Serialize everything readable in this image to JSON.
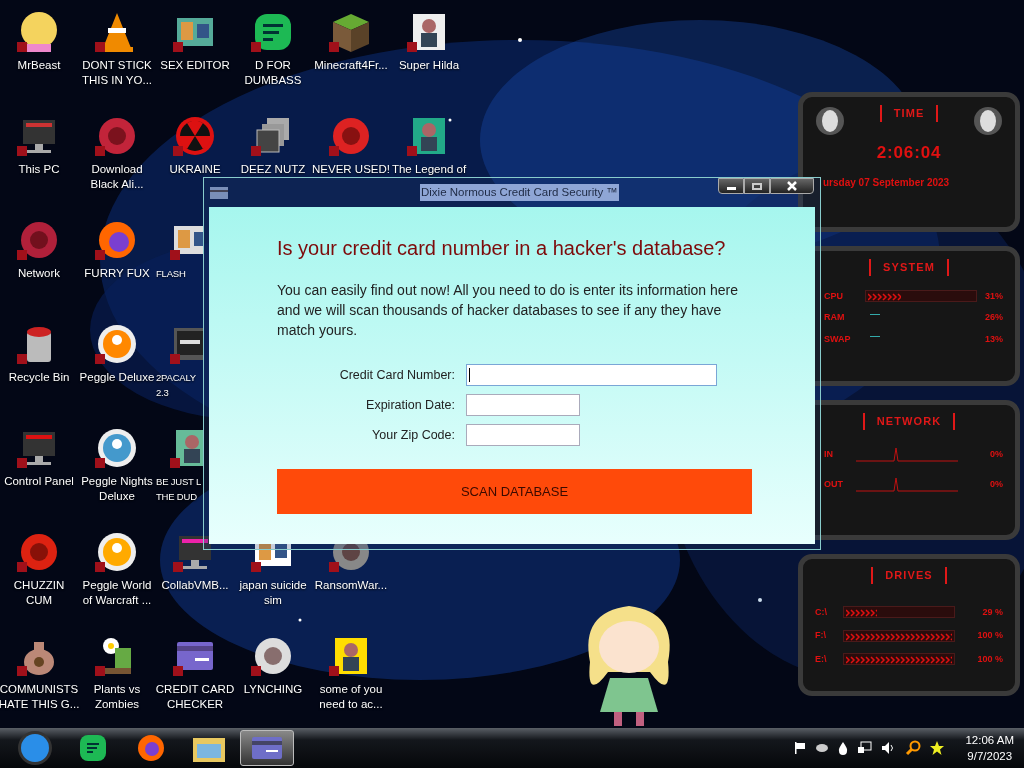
{
  "desktop": {
    "icon_rows": [
      [
        {
          "lines": [
            "MrBeast"
          ]
        },
        {
          "lines": [
            "DONT STICK",
            "THIS IN YO..."
          ]
        },
        {
          "lines": [
            "SEX EDITOR"
          ]
        },
        {
          "lines": [
            "D FOR",
            "DUMBASS"
          ]
        },
        {
          "lines": [
            "Minecraft4Fr..."
          ]
        },
        {
          "lines": [
            "Super Hilda"
          ]
        }
      ],
      [
        {
          "lines": [
            "This PC"
          ]
        },
        {
          "lines": [
            "Download",
            "Black Ali..."
          ]
        },
        {
          "lines": [
            "UKRAINE"
          ]
        },
        {
          "lines": [
            "DEEZ NUTZ"
          ]
        },
        {
          "lines": [
            "NEVER USED!"
          ]
        },
        {
          "lines": [
            "The Legend of"
          ]
        }
      ],
      [
        {
          "lines": [
            "Network"
          ]
        },
        {
          "lines": [
            "FURRY FUX"
          ]
        },
        {
          "lines": [
            "FLASH"
          ]
        }
      ],
      [
        {
          "lines": [
            "Recycle Bin"
          ]
        },
        {
          "lines": [
            "Peggle Deluxe"
          ]
        },
        {
          "lines": [
            "2PACALY",
            "2.3"
          ]
        }
      ],
      [
        {
          "lines": [
            "Control Panel"
          ]
        },
        {
          "lines": [
            "Peggle Nights",
            "Deluxe"
          ]
        },
        {
          "lines": [
            "BE JUST L",
            "THE DUD"
          ]
        }
      ],
      [
        {
          "lines": [
            "CHUZZIN",
            "CUM"
          ]
        },
        {
          "lines": [
            "Peggle World",
            "of Warcraft ..."
          ]
        },
        {
          "lines": [
            "CollabVMB..."
          ]
        },
        {
          "lines": [
            "japan suicide",
            "sim"
          ]
        },
        {
          "lines": [
            "RansomWar..."
          ]
        }
      ],
      [
        {
          "lines": [
            "COMMUNISTS",
            "HATE THIS G..."
          ]
        },
        {
          "lines": [
            "Plants vs",
            "Zombies"
          ]
        },
        {
          "lines": [
            "CREDIT CARD",
            "CHECKER"
          ]
        },
        {
          "lines": [
            "LYNCHING"
          ]
        },
        {
          "lines": [
            "some of you",
            "need to ac..."
          ]
        }
      ]
    ]
  },
  "window": {
    "title": "Dixie Normous Credit Card Security ™",
    "heading": "Is your credit card number in a hacker's database?",
    "body": "You can easily find out now! All you need to do is enter its information here and we will scan thousands of hacker databases to see if any they have match yours.",
    "fields": [
      {
        "label": "Credit Card Number:",
        "focused": true
      },
      {
        "label": "Expiration Date:",
        "focused": false
      },
      {
        "label": "Your Zip Code:",
        "focused": false
      }
    ],
    "button": "SCAN DATABASE"
  },
  "gadget": {
    "time": {
      "title": "TIME",
      "clock": "2:06:04",
      "date": "ursday 07 September 2023"
    },
    "system": {
      "title": "SYSTEM",
      "rows": [
        {
          "label": "CPU",
          "value": "31%",
          "level": 0.31
        },
        {
          "label": "RAM",
          "value": "26%"
        },
        {
          "label": "SWAP",
          "value": "13%"
        }
      ]
    },
    "network": {
      "title": "NETWORK",
      "rows": [
        {
          "label": "IN",
          "value": "0%"
        },
        {
          "label": "OUT",
          "value": "0%"
        }
      ]
    },
    "drives": {
      "title": "DRIVES",
      "rows": [
        {
          "label": "C:\\",
          "value": "29 %",
          "level": 0.29
        },
        {
          "label": "F:\\",
          "value": "100 %",
          "level": 1
        },
        {
          "label": "E:\\",
          "value": "100 %",
          "level": 1
        }
      ]
    }
  },
  "taskbar": {
    "apps": [
      {
        "selected": false
      },
      {
        "selected": false
      },
      {
        "selected": false
      },
      {
        "selected": false
      },
      {
        "selected": true
      }
    ],
    "clock": {
      "time": "12:06 AM",
      "date": "9/7/2023"
    }
  }
}
